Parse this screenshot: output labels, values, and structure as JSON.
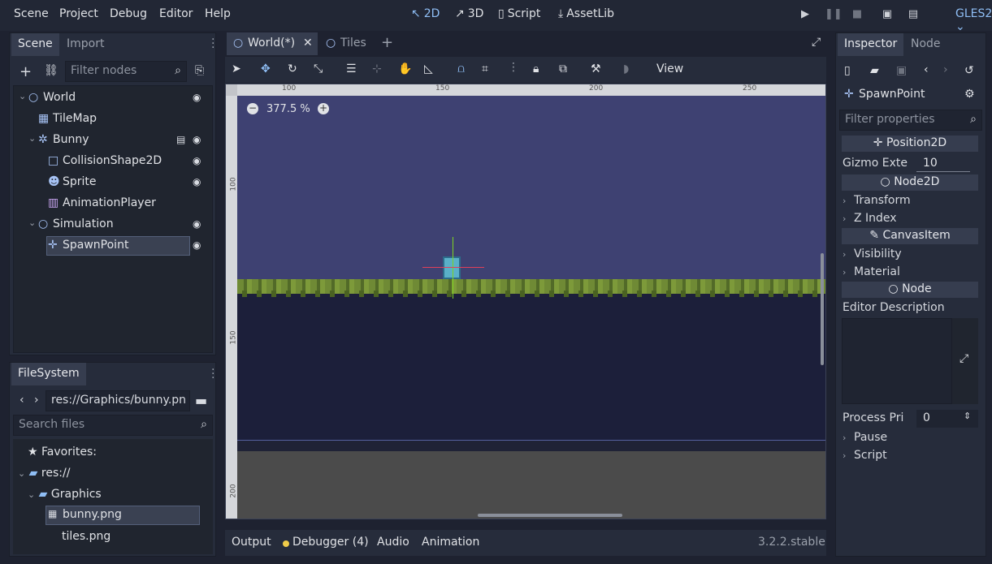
{
  "menu": [
    "Scene",
    "Project",
    "Debug",
    "Editor",
    "Help"
  ],
  "workspaces": [
    {
      "label": "2D",
      "icon": "2d-icon",
      "active": true
    },
    {
      "label": "3D",
      "icon": "3d-icon",
      "active": false
    },
    {
      "label": "Script",
      "icon": "script-icon",
      "active": false
    },
    {
      "label": "AssetLib",
      "icon": "assetlib-icon",
      "active": false
    }
  ],
  "renderer": "GLES2",
  "scene_dock": {
    "tabs": [
      "Scene",
      "Import"
    ],
    "filter_placeholder": "Filter nodes",
    "nodes": [
      {
        "label": "World",
        "icon": "node2d-icon",
        "visible": true
      },
      {
        "label": "TileMap",
        "icon": "tilemap-icon",
        "visible": false
      },
      {
        "label": "Bunny",
        "icon": "kinematic-body-icon",
        "visible": true
      },
      {
        "label": "CollisionShape2D",
        "icon": "collision-shape-icon",
        "visible": true
      },
      {
        "label": "Sprite",
        "icon": "sprite-icon",
        "visible": true
      },
      {
        "label": "AnimationPlayer",
        "icon": "animation-player-icon",
        "visible": false
      },
      {
        "label": "Simulation",
        "icon": "node2d-icon",
        "visible": true
      },
      {
        "label": "SpawnPoint",
        "icon": "position2d-icon",
        "visible": true,
        "selected": true
      }
    ]
  },
  "filesystem": {
    "tab": "FileSystem",
    "path": "res://Graphics/bunny.pn",
    "search_placeholder": "Search files",
    "items": [
      {
        "label": "Favorites:"
      },
      {
        "label": "res://"
      },
      {
        "label": "Graphics"
      },
      {
        "label": "bunny.png",
        "selected": true
      },
      {
        "label": "tiles.png"
      }
    ]
  },
  "editor_tabs": [
    {
      "label": "World(*)",
      "active": true
    },
    {
      "label": "Tiles",
      "active": false
    }
  ],
  "toolbar": {
    "view_label": "View"
  },
  "viewport": {
    "zoom": "377.5 %",
    "ruler_h": [
      "100",
      "150",
      "200",
      "250"
    ],
    "ruler_v": [
      "100",
      "150",
      "200"
    ]
  },
  "bottom": {
    "tabs": [
      "Output",
      "Debugger (4)",
      "Audio",
      "Animation"
    ],
    "version": "3.2.2.stable"
  },
  "inspector": {
    "tabs": [
      "Inspector",
      "Node"
    ],
    "node_name": "SpawnPoint",
    "filter_placeholder": "Filter properties",
    "sections": {
      "position2d": "Position2D",
      "gizmo_label": "Gizmo Exte",
      "gizmo_value": "10",
      "node2d": "Node2D",
      "transform": "Transform",
      "z_index": "Z Index",
      "canvas_item": "CanvasItem",
      "visibility": "Visibility",
      "material": "Material",
      "node": "Node",
      "editor_description": "Editor Description",
      "process_label": "Process Pri",
      "process_value": "0",
      "pause": "Pause",
      "script": "Script"
    }
  },
  "colors": {
    "accent": "#8fbef5",
    "selection": "#3a4152",
    "sky": "#3e4172"
  }
}
